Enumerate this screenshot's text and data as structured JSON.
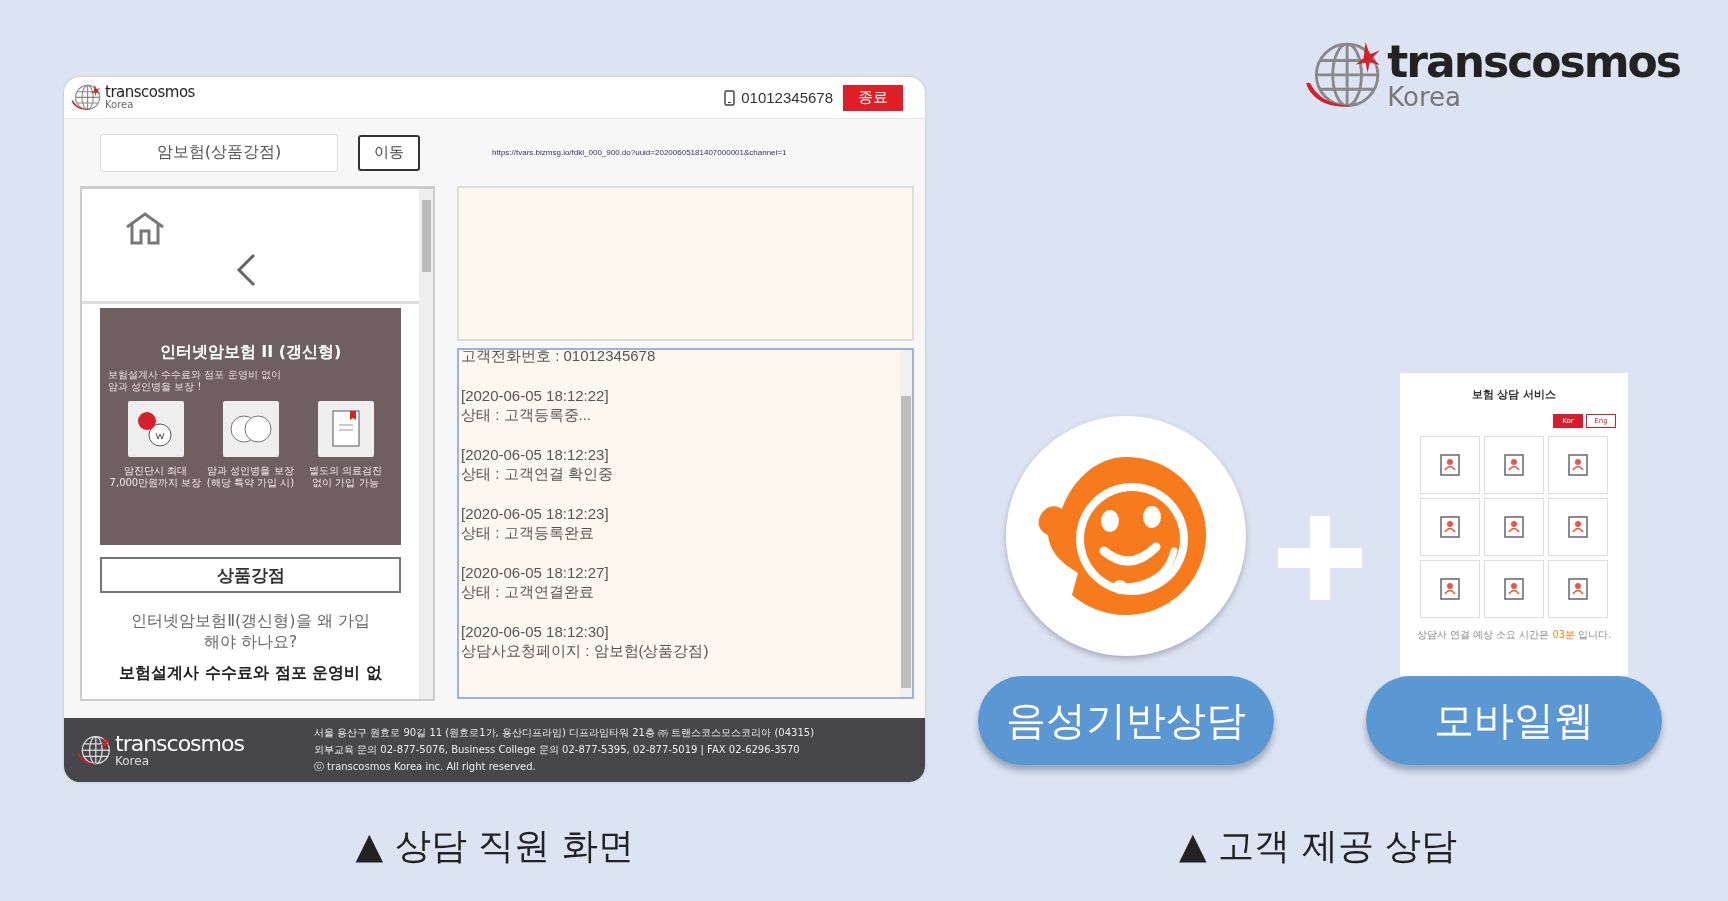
{
  "agent_screen": {
    "header": {
      "logo": {
        "wordmark": "transcosmos",
        "subtitle": "Korea"
      },
      "phone": "01012345678",
      "end_button": "종료"
    },
    "toolbar": {
      "page_select": "암보험(상품강점)",
      "go_button": "이동",
      "url": "https://tvars.bizmsg.io/fdkl_000_900.do?uuid=20200605181407000001&channel=1"
    },
    "mobile_preview": {
      "banner": {
        "title": "인터넷암보험 II (갱신형)",
        "subtitle": "보험설계사 수수료와 점포 운영비 없이\n암과 성인병을 보장 !",
        "features": [
          {
            "kind": "money",
            "caption": "암진단시 최대\n7,000만원까지 보장"
          },
          {
            "kind": "coverage",
            "caption": "암과 성인병을 보장\n(해당 특약 가입 시)"
          },
          {
            "kind": "document",
            "caption": "별도의 의료검진\n없이 가입 가능"
          }
        ]
      },
      "section_button": "상품강점",
      "question": "인터넷암보험Ⅱ(갱신형)을 왜 가입\n해야 하나요?",
      "heading": "보험설계사 수수료와 점포 운영비 없"
    },
    "log": [
      {
        "lines": [
          "고객전화번호 : 01012345678"
        ]
      },
      {
        "lines": [
          "[2020-06-05 18:12:22]",
          "상태 : 고객등록중..."
        ]
      },
      {
        "lines": [
          "[2020-06-05 18:12:23]",
          "상태 : 고객연결 확인중"
        ]
      },
      {
        "lines": [
          "[2020-06-05 18:12:23]",
          "상태 : 고객등록완료"
        ]
      },
      {
        "lines": [
          "[2020-06-05 18:12:27]",
          "상태 : 고객연결완료"
        ]
      },
      {
        "lines": [
          "[2020-06-05 18:12:30]",
          "상담사요청페이지 : 암보험(상품강점)"
        ]
      }
    ],
    "footer": {
      "logo": {
        "wordmark": "transcosmos",
        "subtitle": "Korea"
      },
      "lines": [
        "서울 용산구 원효로 90길 11 (원효로1가, 용산디프라임) 디프라임타워 21층 ㈜ 트랜스코스모스코리아 (04315)",
        "외부교육 문의 02-877-5076, Business College 문의 02-877-5395, 02-877-5019 | FAX 02-6296-3570",
        "ⓒ transcosmos Korea inc. All right reserved."
      ]
    }
  },
  "customer": {
    "logo": {
      "wordmark": "transcosmos",
      "subtitle": "Korea"
    },
    "voice_button": "음성기반상담",
    "mobile_button": "모바일웹",
    "mobile_screen": {
      "title": "보험 상담 서비스",
      "languages": [
        {
          "label": "Kor",
          "selected": true
        },
        {
          "label": "Eng",
          "selected": false
        }
      ],
      "wait_prefix": "상담사 연결 예상 소요 시간은 ",
      "wait_time": "03분",
      "wait_suffix": " 입니다."
    }
  },
  "captions": [
    "▲ 상담 직원 화면",
    "▲ 고객 제공 상담"
  ]
}
